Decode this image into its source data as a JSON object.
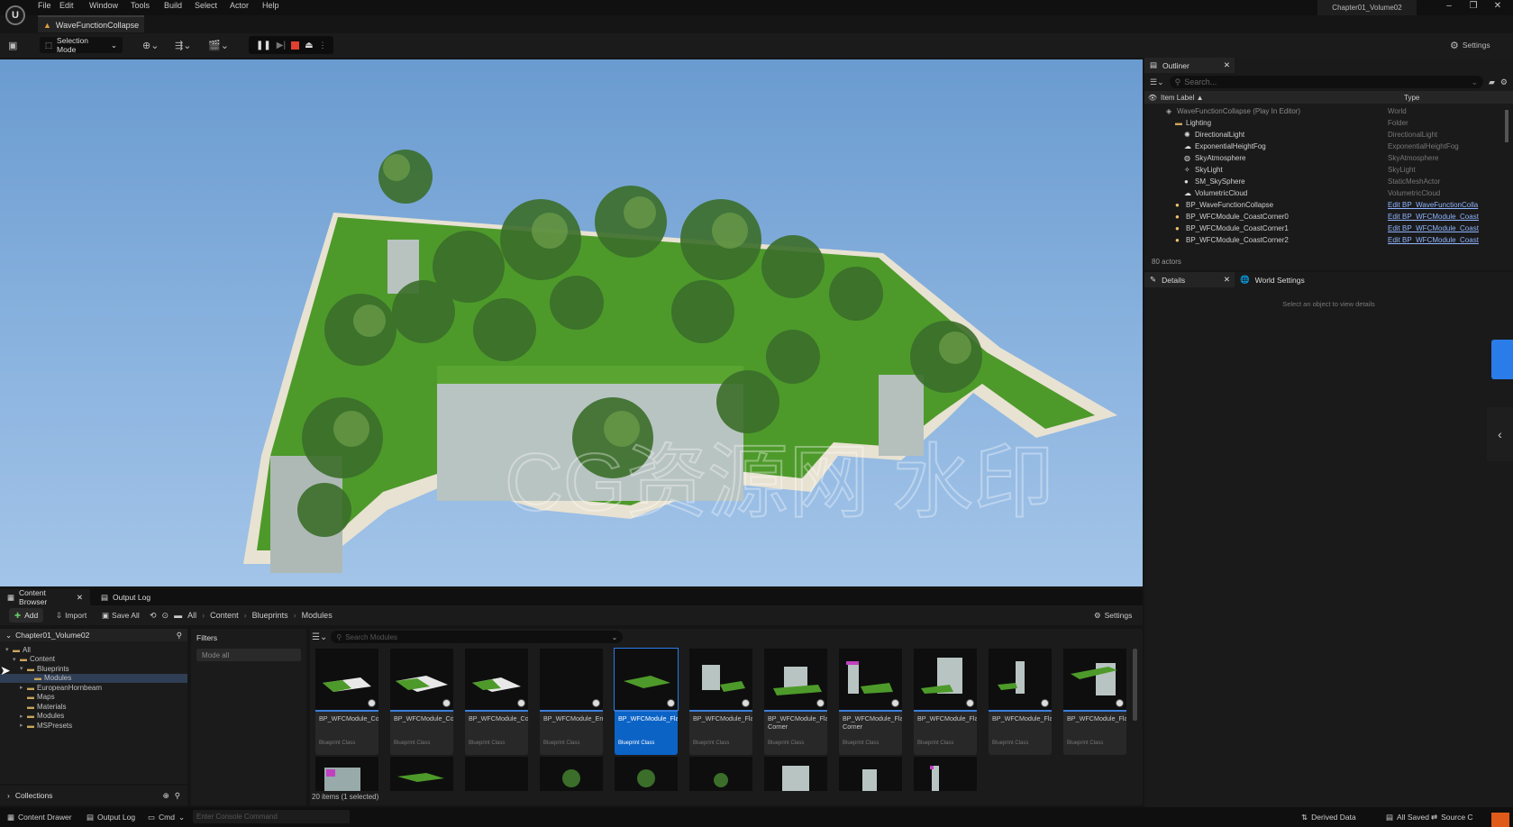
{
  "title_bar": {
    "menu": [
      "File",
      "Edit",
      "Window",
      "Tools",
      "Build",
      "Select",
      "Actor",
      "Help"
    ],
    "project_name": "Chapter01_Volume02"
  },
  "level_tab": {
    "label": "WaveFunctionCollapse"
  },
  "toolbar": {
    "selection_mode": "Selection Mode",
    "settings_label": "Settings"
  },
  "viewport": {
    "watermark": "CG资源网 水印"
  },
  "outliner": {
    "tab_label": "Outliner",
    "search_placeholder": "Search...",
    "col_label": "Item Label ▲",
    "col_type": "Type",
    "rows": [
      {
        "label": "WaveFunctionCollapse (Play In Editor)",
        "type": "World"
      },
      {
        "label": "Lighting",
        "type": "Folder"
      },
      {
        "label": "DirectionalLight",
        "type": "DirectionalLight"
      },
      {
        "label": "ExponentialHeightFog",
        "type": "ExponentialHeightFog"
      },
      {
        "label": "SkyAtmosphere",
        "type": "SkyAtmosphere"
      },
      {
        "label": "SkyLight",
        "type": "SkyLight"
      },
      {
        "label": "SM_SkySphere",
        "type": "StaticMeshActor"
      },
      {
        "label": "VolumetricCloud",
        "type": "VolumetricCloud"
      },
      {
        "label": "BP_WaveFunctionCollapse",
        "type": "Edit BP_WaveFunctionColla"
      },
      {
        "label": "BP_WFCModule_CoastCorner0",
        "type": "Edit BP_WFCModule_Coast"
      },
      {
        "label": "BP_WFCModule_CoastCorner1",
        "type": "Edit BP_WFCModule_Coast"
      },
      {
        "label": "BP_WFCModule_CoastCorner2",
        "type": "Edit BP_WFCModule_Coast"
      }
    ],
    "actor_count": "80 actors"
  },
  "details": {
    "tab_details": "Details",
    "tab_world_settings": "World Settings",
    "empty_text": "Select an object to view details"
  },
  "content_browser": {
    "tab_label": "Content Browser",
    "output_log_tab": "Output Log",
    "add": "Add",
    "import": "Import",
    "save_all": "Save All",
    "breadcrumb": [
      "All",
      "Content",
      "Blueprints",
      "Modules"
    ],
    "settings": "Settings",
    "tree_root": "Chapter01_Volume02",
    "tree": [
      {
        "label": "All",
        "depth": 0
      },
      {
        "label": "Content",
        "depth": 1
      },
      {
        "label": "Blueprints",
        "depth": 2
      },
      {
        "label": "Modules",
        "depth": 3
      },
      {
        "label": "EuropeanHornbeam",
        "depth": 2
      },
      {
        "label": "Maps",
        "depth": 2
      },
      {
        "label": "Materials",
        "depth": 2
      },
      {
        "label": "Modules",
        "depth": 2
      },
      {
        "label": "MSPresets",
        "depth": 2
      }
    ],
    "filters_label": "Filters",
    "filter_item": "Mode all",
    "search_placeholder": "Search Modules",
    "assets": [
      {
        "name": "BP_WFCModule_CoastCorner",
        "type": "Blueprint Class"
      },
      {
        "name": "BP_WFCModule_CoastCornerInside",
        "type": "Blueprint Class"
      },
      {
        "name": "BP_WFCModule_CoastFlat",
        "type": "Blueprint Class"
      },
      {
        "name": "BP_WFCModule_Empty",
        "type": "Blueprint Class"
      },
      {
        "name": "BP_WFCModule_Flat",
        "type": "Blueprint Class"
      },
      {
        "name": "BP_WFCModule_FlatToVertBot",
        "type": "Blueprint Class"
      },
      {
        "name": "BP_WFCModule_FlatToVertBot Corner",
        "type": "Blueprint Class"
      },
      {
        "name": "BP_WFCModule_FlatToVertBottom Corner",
        "type": "Blueprint Class"
      },
      {
        "name": "BP_WFCModule_FlatToVertEdge",
        "type": "Blueprint Class"
      },
      {
        "name": "BP_WFCModule_FlatToVertEdgeM",
        "type": "Blueprint Class"
      },
      {
        "name": "BP_WFCModule_FlatToVertTop",
        "type": "Blueprint Class"
      }
    ],
    "item_count": "20 items (1 selected)",
    "collections": "Collections"
  },
  "status_bar": {
    "content_drawer": "Content Drawer",
    "output_log": "Output Log",
    "cmd": "Cmd",
    "console_placeholder": "Enter Console Command",
    "derived_data": "Derived Data",
    "all_saved": "All Saved",
    "source_control": "Source C"
  }
}
